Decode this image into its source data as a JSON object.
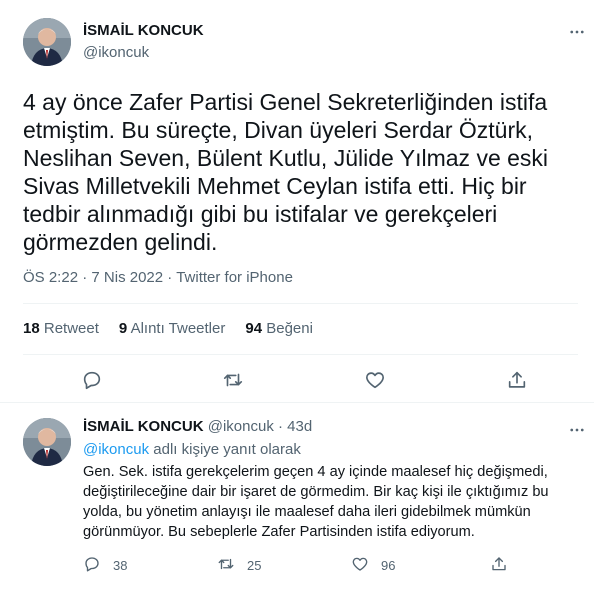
{
  "tweet": {
    "author_name": "İSMAİL KONCUK",
    "author_handle": "@ikoncuk",
    "text": "4 ay önce Zafer Partisi Genel Sekreterliğinden istifa etmiştim. Bu süreçte, Divan üyeleri Serdar Öztürk, Neslihan Seven, Bülent Kutlu, Jülide Yılmaz ve eski Sivas Milletvekili Mehmet Ceylan istifa etti. Hiç bir tedbir alınmadığı gibi bu istifalar ve gerekçeleri görmezden gelindi.",
    "time": "ÖS 2:22",
    "separator": "·",
    "date": "7 Nis 2022",
    "source": "Twitter for iPhone"
  },
  "stats": {
    "retweets_count": "18",
    "retweets_label": "Retweet",
    "quotes_count": "9",
    "quotes_label": "Alıntı Tweetler",
    "likes_count": "94",
    "likes_label": "Beğeni"
  },
  "reply": {
    "author_name": "İSMAİL KONCUK",
    "author_handle": "@ikoncuk",
    "separator": "·",
    "time": "43d",
    "replying_mention": "@ikoncuk",
    "replying_suffix": " adlı kişiye yanıt olarak",
    "text": "Gen. Sek. istifa gerekçelerim geçen 4 ay içinde maalesef hiç değişmedi, değiştirileceğine dair bir işaret de görmedim. Bir kaç kişi ile çıktığımız bu yolda, bu yönetim anlayışı ile maalesef daha ileri gidebilmek mümkün görünmüyor. Bu sebeplerle Zafer Partisinden istifa ediyorum.",
    "reply_count": "38",
    "retweet_count": "25",
    "like_count": "96"
  },
  "icons": {
    "more": "more-horizontal-icon",
    "reply": "reply-icon",
    "retweet": "retweet-icon",
    "like": "heart-icon",
    "share": "share-icon"
  },
  "colors": {
    "text": "#0f1419",
    "secondary": "#536471",
    "link": "#1d9bf0",
    "divider": "#eff3f4"
  }
}
